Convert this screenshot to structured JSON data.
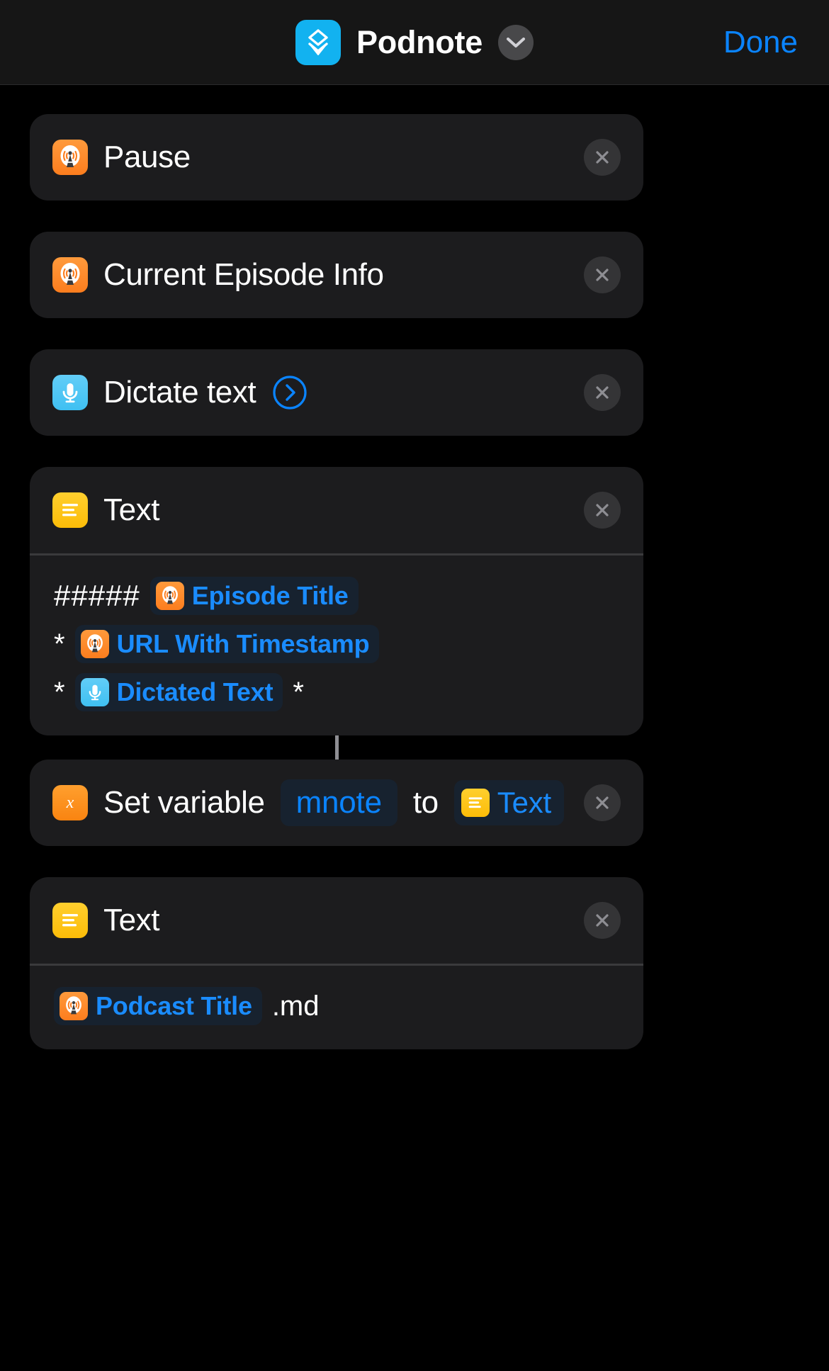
{
  "header": {
    "app_icon_name": "podnote-app-icon",
    "app_icon_color": "#12b2f0",
    "title": "Podnote",
    "chevron_icon": "chevron-down-icon",
    "done_label": "Done",
    "done_color": "#0a84ff"
  },
  "colors": {
    "background": "#000000",
    "card": "#1c1c1e",
    "token_pill": "#17222f",
    "token_text": "#1a8cff",
    "accent_blue": "#0a84ff",
    "overcast_orange": "#fc7d1e",
    "text_yellow": "#fcbc08",
    "mic_cyan": "#3fc0f2",
    "close_button": "#343436"
  },
  "actions": [
    {
      "name": "pause",
      "icon": "overcast-icon",
      "label": "Pause",
      "close_label": "×",
      "has_body": false,
      "has_disclosure": false
    },
    {
      "name": "current-episode-info",
      "icon": "overcast-icon",
      "label": "Current Episode Info",
      "close_label": "×",
      "has_body": false,
      "has_disclosure": false
    },
    {
      "name": "dictate-text",
      "icon": "microphone-icon",
      "label": "Dictate text",
      "disclosure_icon": "chevron-right-circle-icon",
      "close_label": "×",
      "has_body": false,
      "has_disclosure": true
    },
    {
      "name": "text-note-body",
      "icon": "text-icon",
      "label": "Text",
      "close_label": "×",
      "has_body": true,
      "body_lines": [
        {
          "parts": [
            {
              "type": "plain",
              "value": "#####"
            },
            {
              "type": "token",
              "icon": "overcast-icon",
              "value": "Episode Title"
            }
          ]
        },
        {
          "parts": [
            {
              "type": "plain",
              "value": "*"
            },
            {
              "type": "token",
              "icon": "overcast-icon",
              "value": "URL With Timestamp"
            }
          ]
        },
        {
          "parts": [
            {
              "type": "plain",
              "value": "*"
            },
            {
              "type": "token",
              "icon": "microphone-icon",
              "value": "Dictated Text"
            },
            {
              "type": "plain",
              "value": "*"
            }
          ]
        }
      ]
    },
    {
      "name": "set-variable",
      "icon": "variable-x-icon",
      "label_part_1": "Set variable",
      "variable_name": "mnote",
      "label_part_2": "to",
      "value_token": {
        "icon": "text-icon",
        "value": "Text"
      },
      "close_label": "×"
    },
    {
      "name": "text-filename",
      "icon": "text-icon",
      "label": "Text",
      "close_label": "×",
      "has_body": true,
      "body_lines": [
        {
          "parts": [
            {
              "type": "token",
              "icon": "overcast-icon",
              "value": "Podcast Title"
            },
            {
              "type": "plain",
              "value": ".md"
            }
          ]
        }
      ]
    }
  ]
}
